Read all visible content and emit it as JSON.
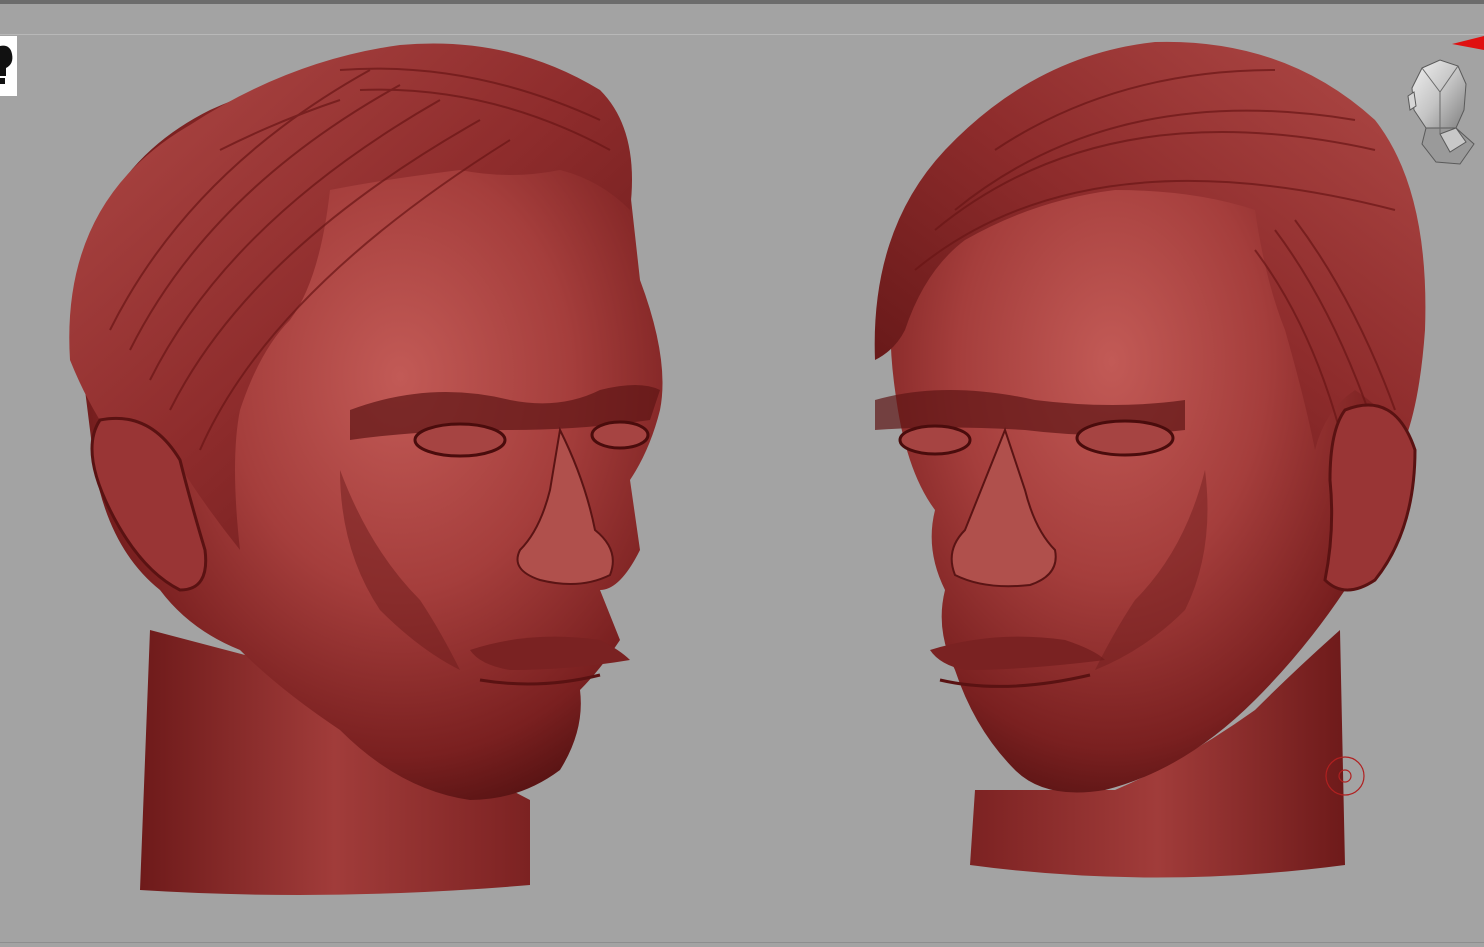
{
  "app": {
    "name": "",
    "canvas_background": "#a3a3a3"
  },
  "model": {
    "material_color": "#8f2f2f",
    "material_highlight": "#c45a58",
    "material_shadow": "#3e0c0c",
    "views": [
      "three-quarter-left",
      "three-quarter-right"
    ]
  },
  "navigator": {
    "icon": "head-navigation-gizmo"
  },
  "cursor": {
    "icon": "brush-cursor-icon",
    "color": "#b02020"
  },
  "markers": {
    "top_right_color": "#e01010"
  }
}
